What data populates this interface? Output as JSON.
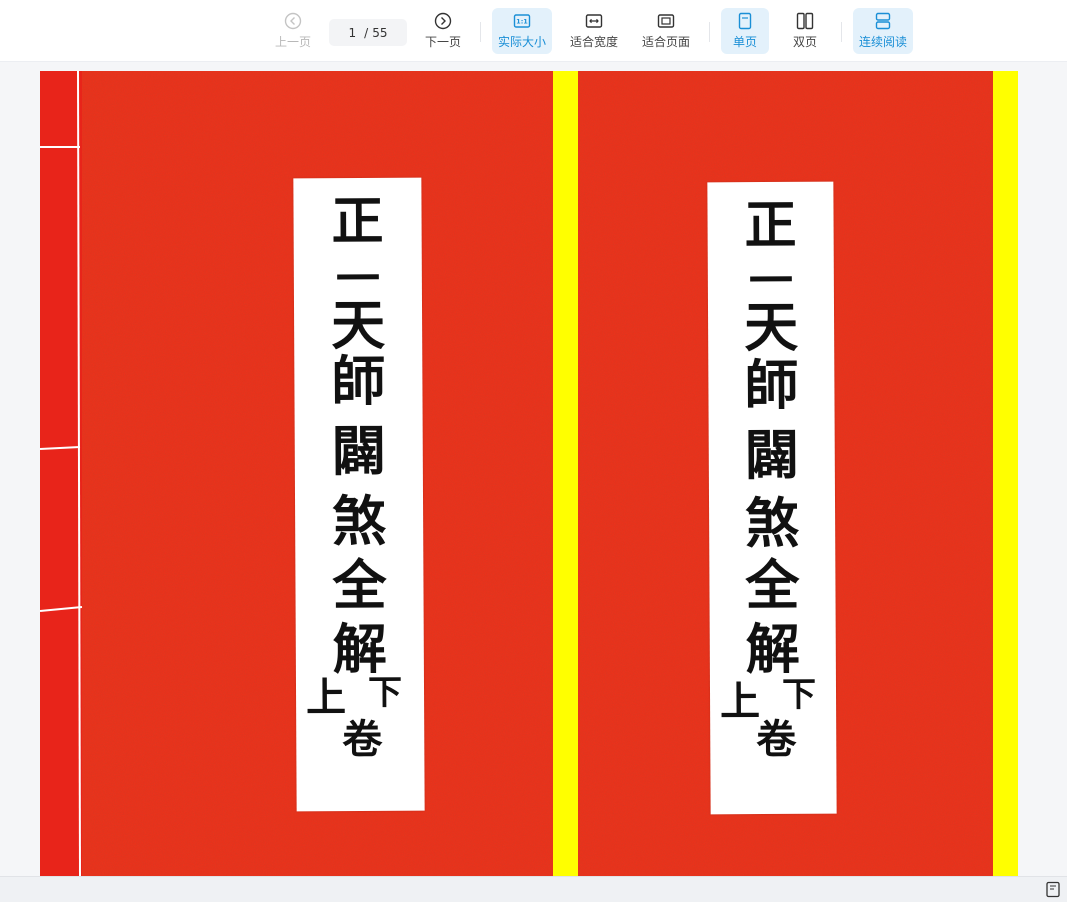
{
  "toolbar": {
    "prev_label": "上一页",
    "next_label": "下一页",
    "page_current": "1",
    "page_sep": "/",
    "page_total": "55",
    "actual_size_label": "实际大小",
    "fit_width_label": "适合宽度",
    "fit_page_label": "适合页面",
    "single_page_label": "单页",
    "double_page_label": "双页",
    "continuous_label": "连续阅读",
    "actual_size_icon_text": "1:1",
    "active_color": "#1a8fd6"
  },
  "document": {
    "cover_color": "#f0301a",
    "edge_color": "#ffff00",
    "left_cover": {
      "title_chars": [
        "正",
        "一",
        "天",
        "師",
        "闢",
        "煞",
        "全",
        "解"
      ],
      "volume_left": "上",
      "volume_right_top": "下",
      "volume_bottom": "卷"
    },
    "right_cover": {
      "title_chars": [
        "正",
        "一",
        "天",
        "師",
        "闢",
        "煞",
        "全",
        "解"
      ],
      "volume_left": "上",
      "volume_right_top": "下",
      "volume_bottom": "卷"
    }
  },
  "icons": {
    "prev": "chevron-left-circle-icon",
    "next": "chevron-right-circle-icon",
    "actual_size": "one-to-one-icon",
    "fit_width": "fit-width-icon",
    "fit_page": "fit-page-icon",
    "single_page": "single-page-icon",
    "double_page": "double-page-icon",
    "continuous": "continuous-scroll-icon",
    "status": "page-icon"
  }
}
